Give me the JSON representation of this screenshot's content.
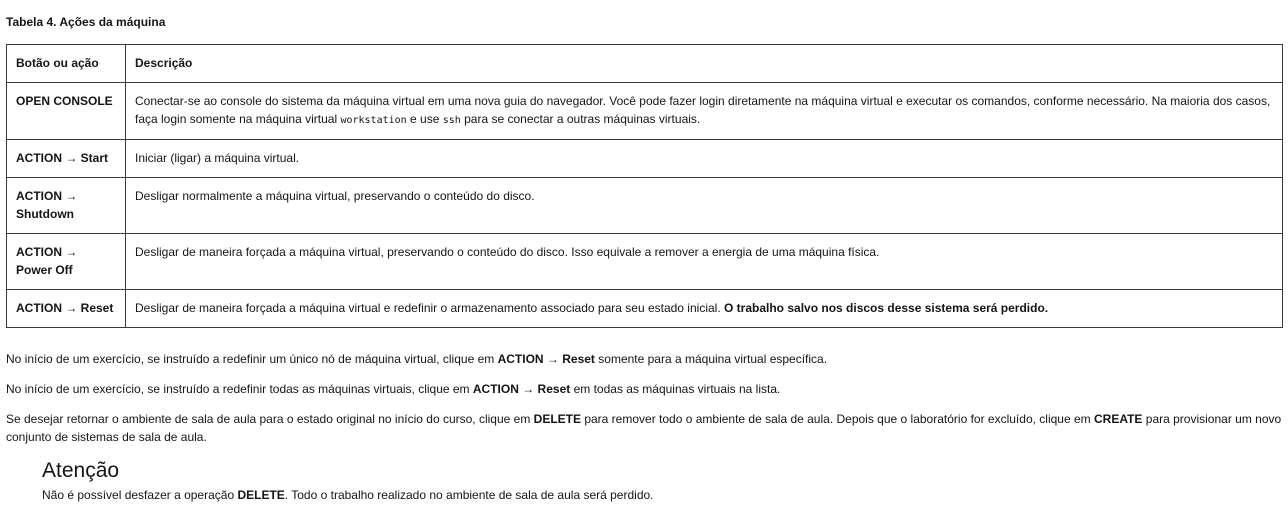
{
  "caption": "Tabela 4. Ações da máquina",
  "table": {
    "headers": [
      "Botão ou ação",
      "Descrição"
    ],
    "rows": [
      {
        "action": "OPEN CONSOLE",
        "desc_part1": "Conectar-se ao console do sistema da máquina virtual em uma nova guia do navegador. Você pode fazer login diretamente na máquina virtual e executar os comandos, conforme necessário. Na maioria dos casos, faça login somente na máquina virtual ",
        "code1": "workstation",
        "desc_part2": " e use ",
        "code2": "ssh",
        "desc_part3": " para se conectar a outras máquinas virtuais."
      },
      {
        "action": "ACTION → Start",
        "desc": "Iniciar (ligar) a máquina virtual."
      },
      {
        "action": "ACTION → Shutdown",
        "desc": "Desligar normalmente a máquina virtual, preservando o conteúdo do disco."
      },
      {
        "action": "ACTION → Power Off",
        "desc": "Desligar de maneira forçada a máquina virtual, preservando o conteúdo do disco. Isso equivale a remover a energia de uma máquina física."
      },
      {
        "action": "ACTION → Reset",
        "desc": "Desligar de maneira forçada a máquina virtual e redefinir o armazenamento associado para seu estado inicial. ",
        "desc_bold": "O trabalho salvo nos discos desse sistema será perdido."
      }
    ]
  },
  "paragraphs": {
    "p1_a": "No início de um exercício, se instruído a redefinir um único nó de máquina virtual, clique em ",
    "p1_b": "ACTION → Reset",
    "p1_c": " somente para a máquina virtual específica.",
    "p2_a": "No início de um exercício, se instruído a redefinir todas as máquinas virtuais, clique em ",
    "p2_b": "ACTION → Reset",
    "p2_c": " em todas as máquinas virtuais na lista.",
    "p3_a": "Se desejar retornar o ambiente de sala de aula para o estado original no início do curso, clique em ",
    "p3_b": "DELETE",
    "p3_c": " para remover todo o ambiente de sala de aula. Depois que o laboratório for excluído, clique em ",
    "p3_d": "CREATE",
    "p3_e": " para provisionar um novo conjunto de sistemas de sala de aula."
  },
  "admonition": {
    "title": "Atenção",
    "body_a": "Não é possível desfazer a operação ",
    "body_b": "DELETE",
    "body_c": ". Todo o trabalho realizado no ambiente de sala de aula será perdido."
  }
}
